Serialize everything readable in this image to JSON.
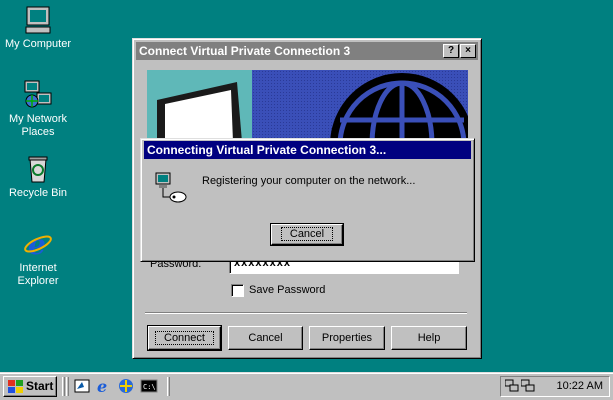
{
  "desktop": {
    "icons": [
      {
        "label": "My Computer"
      },
      {
        "label": "My Network Places"
      },
      {
        "label": "Recycle Bin"
      },
      {
        "label": "Internet Explorer"
      }
    ]
  },
  "connect_dialog": {
    "title": "Connect Virtual Private Connection 3",
    "help_button": "?",
    "close_button": "×",
    "password_label": "Password:",
    "password_value": "xxxxxxxx",
    "save_password_label": "Save Password",
    "save_password_checked": false,
    "buttons": {
      "connect": "Connect",
      "cancel": "Cancel",
      "properties": "Properties",
      "help": "Help"
    }
  },
  "progress_dialog": {
    "title": "Connecting Virtual Private Connection 3...",
    "message": "Registering your computer on the network...",
    "cancel_button": "Cancel"
  },
  "taskbar": {
    "start_label": "Start",
    "clock": "10:22 AM"
  },
  "colors": {
    "desktop": "#008080",
    "active_title": "#000080",
    "inactive_title": "#808080",
    "face": "#c0c0c0"
  }
}
